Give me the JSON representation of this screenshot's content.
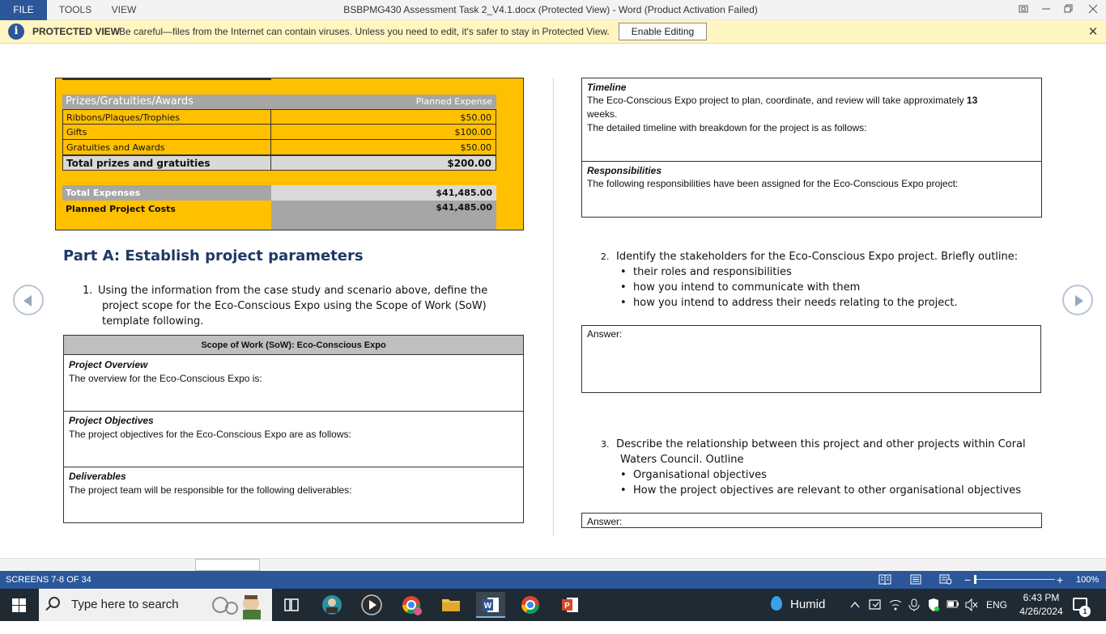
{
  "titlebar": {
    "menu": [
      "FILE",
      "TOOLS",
      "VIEW"
    ],
    "title": "BSBPMG430 Assessment Task 2_V4.1.docx (Protected View) - Word (Product Activation Failed)"
  },
  "protected_view": {
    "label": "PROTECTED VIEW",
    "message": "Be careful—files from the Internet can contain viruses. Unless you need to edit, it's safer to stay in Protected View.",
    "enable_button": "Enable Editing",
    "icon": "info-icon",
    "close": "✕"
  },
  "budget": {
    "header_label": "Prizes/Gratuities/Awards",
    "header_col": "Planned  Expense",
    "items": [
      {
        "label": "Ribbons/Plaques/Trophies",
        "value": "$50.00"
      },
      {
        "label": "Gifts",
        "value": "$100.00"
      },
      {
        "label": "Gratuities and Awards",
        "value": "$50.00"
      }
    ],
    "total_label": "Total prizes and gratuities",
    "total_value": "$200.00",
    "expenses_label": "Total Expenses",
    "expenses_value": "$41,485.00",
    "planned_label": "Planned Project Costs",
    "planned_value": "$41,485.00"
  },
  "part_a": {
    "heading": "Part A: Establish project parameters",
    "q1_num": "1.",
    "q1_line1": "Using the information from the case study and scenario above, define the",
    "q1_line2": "project scope for the Eco-Conscious Expo using the Scope of Work (SoW)",
    "q1_line3": "template following."
  },
  "sow": {
    "title": "Scope of Work (SoW): Eco-Conscious Expo",
    "sections": [
      {
        "title": "Project Overview",
        "body": "The overview for the Eco-Conscious Expo is:"
      },
      {
        "title": "Project Objectives",
        "body": "The project objectives for the Eco-Conscious Expo are as follows:"
      },
      {
        "title": "Deliverables",
        "body": "The project team will be responsible for the following deliverables:"
      }
    ]
  },
  "timeline": {
    "title": "Timeline",
    "line1_pre": "The Eco-Conscious Expo project to plan, coordinate, and review will take approximately ",
    "line1_bold": "13",
    "line2": "weeks.",
    "line3": "The detailed timeline with breakdown for the project is as follows:",
    "resp_title": "Responsibilities",
    "resp_body": "The following responsibilities have been assigned for the Eco-Conscious Expo project:"
  },
  "q2": {
    "num": "2.",
    "text": "Identify the stakeholders for the Eco-Conscious Expo project. Briefly outline:",
    "bullets": [
      "their roles and responsibilities",
      "how you intend to communicate with them",
      "how you intend to address their needs relating to the project."
    ],
    "answer": "Answer:"
  },
  "q3": {
    "num": "3.",
    "line1": "Describe the relationship between this project and other projects within Coral",
    "line2": "Waters Council. Outline",
    "bullets": [
      "Organisational objectives",
      "How the project objectives are relevant to other organisational objectives"
    ],
    "answer": "Answer:"
  },
  "statusbar": {
    "screens": "SCREENS 7-8 OF 34",
    "zoom": "100%",
    "zoom_minus": "−",
    "zoom_plus": "+"
  },
  "taskbar": {
    "search_placeholder": "Type here to search",
    "weather": "Humid",
    "language": "ENG",
    "time": "6:43 PM",
    "date": "4/26/2024",
    "notification_count": "1",
    "apps": [
      "task-view-icon",
      "photo-app-icon",
      "media-player-icon",
      "chrome-profile-icon",
      "file-explorer-icon",
      "word-icon",
      "chrome-icon",
      "powerpoint-icon"
    ]
  },
  "colors": {
    "word_blue": "#2b579a",
    "protected_yellow": "#fff6c1",
    "budget_gold": "#ffc000",
    "heading_navy": "#1f3864",
    "taskbar": "#1f2a33"
  }
}
